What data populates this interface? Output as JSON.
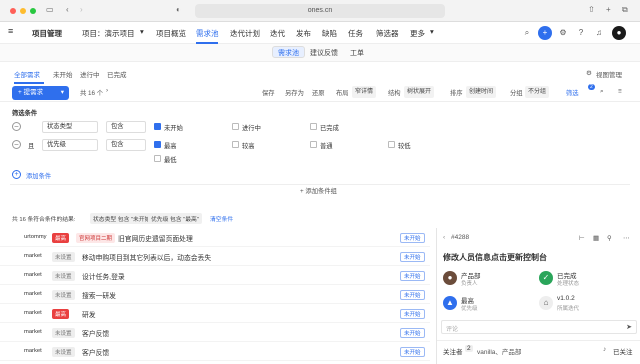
{
  "browser": {
    "url": "ones.cn"
  },
  "app": {
    "title": "项目管理",
    "project": "项目：演示项目",
    "nav": [
      "项目概览",
      "需求池",
      "迭代计划",
      "迭代",
      "发布",
      "缺陷",
      "任务",
      "筛选器",
      "更多"
    ],
    "active_nav": "需求池"
  },
  "subnav": [
    "需求池",
    "建议反馈",
    "工单"
  ],
  "tabs": [
    "全部需求",
    "未开始",
    "进行中",
    "已完成"
  ],
  "view_mode": "视图管理",
  "toolbar": {
    "create": "+ 提需求",
    "count": "共 16 个",
    "actions": [
      "保存",
      "另存为",
      "还原"
    ],
    "layout_label": "布局",
    "layout_value": "窄详情",
    "structure_label": "结构",
    "structure_value": "树状展开",
    "sort_label": "排序",
    "sort_value": "创建时间",
    "group_label": "分组",
    "group_value": "不分组",
    "filter_label": "筛选",
    "filter_badge": "2"
  },
  "filter": {
    "title": "筛选条件",
    "row1": {
      "field": "状态类型",
      "op": "包含",
      "options": [
        {
          "label": "未开始",
          "checked": true
        },
        {
          "label": "进行中",
          "checked": false
        },
        {
          "label": "已完成",
          "checked": false
        }
      ]
    },
    "row2": {
      "conj": "且",
      "field": "优先级",
      "op": "包含",
      "options": [
        {
          "label": "最高",
          "checked": true
        },
        {
          "label": "较高",
          "checked": false
        },
        {
          "label": "普通",
          "checked": false
        },
        {
          "label": "较低",
          "checked": false
        },
        {
          "label": "最低",
          "checked": false
        }
      ]
    },
    "add_condition": "添加条件",
    "add_group": "+ 添加条件组"
  },
  "conditions": {
    "summary": "共 16 条符合条件的结果:",
    "chips": [
      "状态类型 包含 \"未开始\"",
      "优先级 包含 \"最高\""
    ],
    "clear": "清空条件"
  },
  "list": [
    {
      "user": "urtommy",
      "priority": "最高",
      "hi": true,
      "project": "官网项目二期",
      "title": "旧官网历史遗留页面处理",
      "status": "未开始"
    },
    {
      "user": "market",
      "priority": "未设置",
      "hi": false,
      "project": "",
      "title": "移动申购项目到其它列表以后，动态会丢失",
      "status": "未开始"
    },
    {
      "user": "market",
      "priority": "未设置",
      "hi": false,
      "project": "",
      "title": "设计任务,登录",
      "status": "未开始"
    },
    {
      "user": "market",
      "priority": "未设置",
      "hi": false,
      "project": "",
      "title": "搜索一研发",
      "status": "未开始"
    },
    {
      "user": "market",
      "priority": "最高",
      "hi": true,
      "project": "",
      "title": "研发",
      "status": "未开始"
    },
    {
      "user": "market",
      "priority": "未设置",
      "hi": false,
      "project": "",
      "title": "客户反馈",
      "status": "未开始"
    },
    {
      "user": "market",
      "priority": "未设置",
      "hi": false,
      "project": "",
      "title": "客户反馈",
      "status": "未开始"
    }
  ],
  "detail": {
    "id": "#4288",
    "title": "修改人员信息点击更新控制台",
    "owner": "产品部",
    "owner_label": "负责人",
    "status": "已完成",
    "status_label": "处理状态",
    "priority": "最高",
    "priority_label": "优先级",
    "version": "v1.0.2",
    "version_label": "所属迭代",
    "comment_placeholder": "评论",
    "watchers_label": "关注者",
    "watchers_count": "2",
    "watchers": "vanilla、产品部",
    "follow": "已关注"
  }
}
